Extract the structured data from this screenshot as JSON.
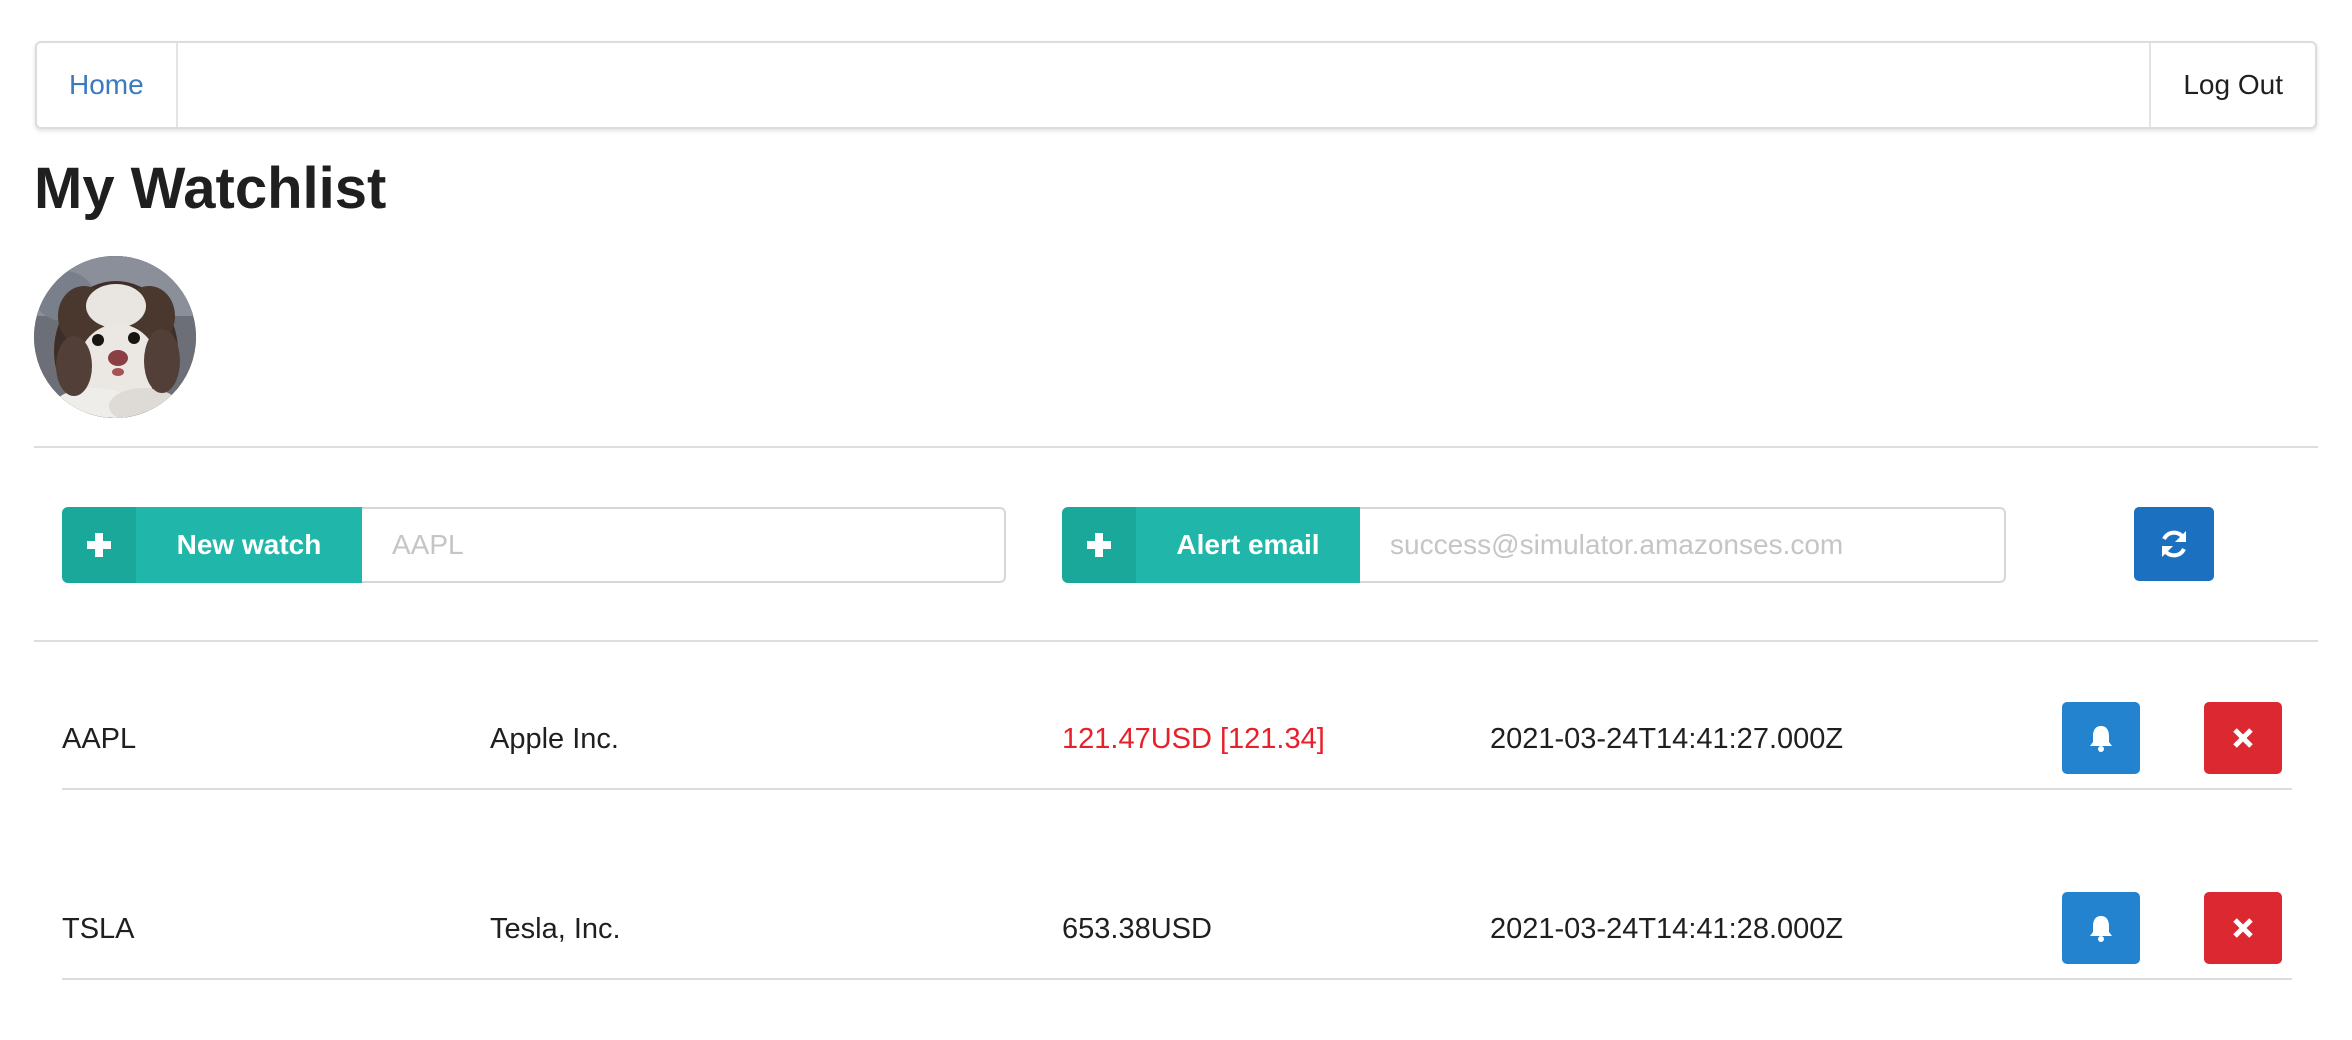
{
  "menu": {
    "home_label": "Home",
    "logout_label": "Log Out"
  },
  "page": {
    "title": "My Watchlist"
  },
  "new_watch": {
    "button_label": "New watch",
    "placeholder": "AAPL",
    "icon": "plus-icon"
  },
  "alert_email": {
    "button_label": "Alert email",
    "placeholder": "success@simulator.amazonses.com",
    "icon": "plus-icon"
  },
  "refresh": {
    "icon": "refresh-icon"
  },
  "watchlist": [
    {
      "symbol": "AAPL",
      "name": "Apple Inc.",
      "price": "121.47USD [121.34]",
      "price_alert": true,
      "timestamp": "2021-03-24T14:41:27.000Z"
    },
    {
      "symbol": "TSLA",
      "name": "Tesla, Inc.",
      "price": "653.38USD",
      "price_alert": false,
      "timestamp": "2021-03-24T14:41:28.000Z"
    }
  ],
  "colors": {
    "teal_dark": "#1aa89b",
    "teal": "#20b7aa",
    "blue": "#1b70c0",
    "bell_blue": "#2483cf",
    "delete_red": "#dc2831",
    "alert_price": "#e8202a",
    "link_blue": "#3a7bbf"
  }
}
